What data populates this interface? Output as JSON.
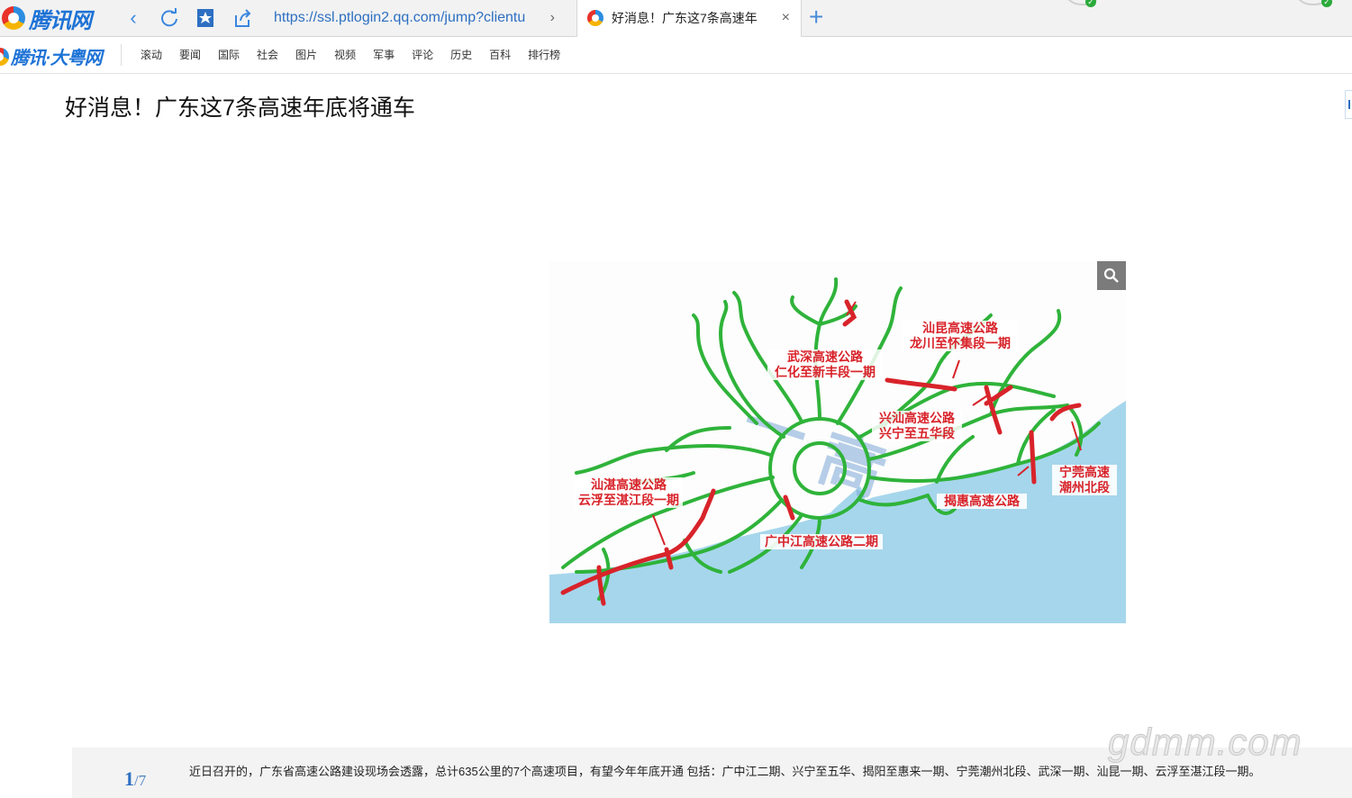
{
  "browser": {
    "brand": "腾讯网",
    "url": "https://ssl.ptlogin2.qq.com/jump?clientu",
    "tab_title": "好消息！广东这7条高速年",
    "close_glyph": "×",
    "new_tab_glyph": "+"
  },
  "site": {
    "brand": "腾讯·大粤网",
    "menu": [
      "滚动",
      "要闻",
      "国际",
      "社会",
      "图片",
      "视频",
      "军事",
      "评论",
      "历史",
      "百科",
      "排行榜"
    ]
  },
  "article": {
    "headline": "好消息！广东这7条高速年底将通车",
    "figure_labels": [
      "武深高速公路\n仁化至新丰段一期",
      "汕昆高速公路\n龙川至怀集段一期",
      "兴汕高速公路\n兴宁至五华段",
      "汕湛高速公路\n云浮至湛江段一期",
      "宁莞高速\n潮州北段",
      "揭惠高速公路",
      "广中江高速公路二期"
    ],
    "caption": "近日召开的，广东省高速公路建设现场会透露，总计635公里的7个高速项目，有望今年年底开通 包括：广中江二期、兴宁至五华、揭阳至惠来一期、宁莞潮州北段、武深一期、汕昆一期、云浮至湛江段一期。",
    "pager": {
      "current": "1",
      "separator": "/",
      "total": "7"
    }
  },
  "watermark": "gdmm.com",
  "colors": {
    "accent": "#2d6fc2",
    "road_green": "#2fb33a",
    "road_red": "#d8232a",
    "sea": "#9fd3ea"
  }
}
